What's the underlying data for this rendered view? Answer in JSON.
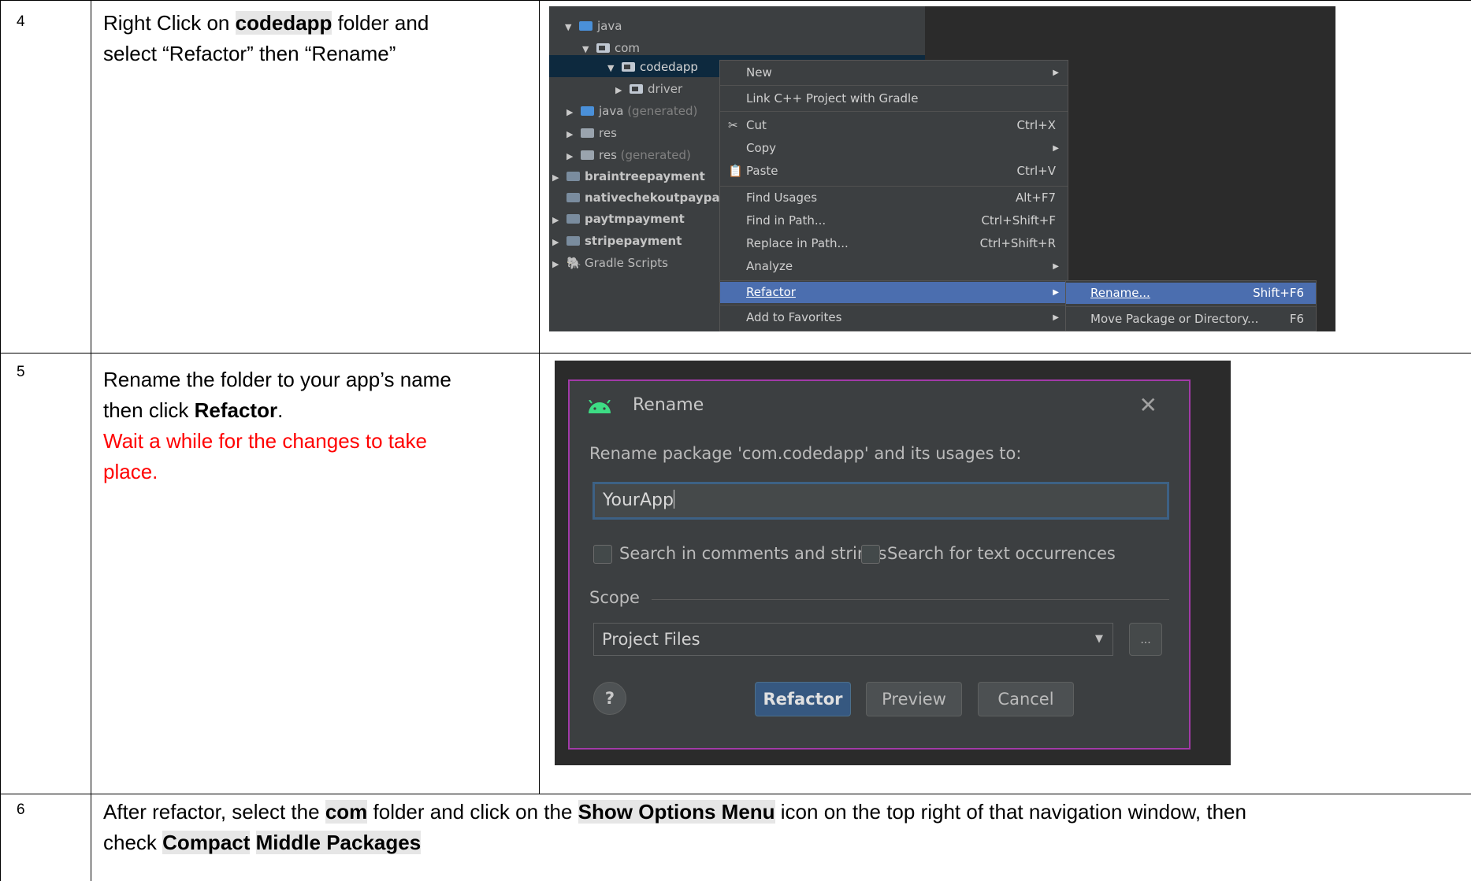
{
  "rows": [
    {
      "num": "4",
      "text_1": "Right Click on ",
      "hl_1": "codedapp",
      "text_2": " folder and",
      "line2": "select “Refactor” then “Rename”"
    },
    {
      "num": "5",
      "line1": "Rename the folder to your app’s name",
      "line2_pre": "then click ",
      "line2_bold": "Refactor",
      "line2_post": ".",
      "warn_line1": "Wait a while for the changes to take",
      "warn_line2": "place.",
      "warn_color": "#ff0000"
    },
    {
      "num": "6",
      "t1": "After refactor, select the ",
      "h1": "com",
      "t2": " folder and click on the ",
      "h2": "Show Options Menu",
      "t3": " icon on the top right of that navigation window, then",
      "t4": "check ",
      "h3": "Compact",
      "h4": "Middle Packages"
    }
  ],
  "ide": {
    "tree": [
      {
        "label": "java",
        "extra": ""
      },
      {
        "label": "com",
        "extra": ""
      },
      {
        "label": "codedapp",
        "extra": ""
      },
      {
        "label": "driver",
        "extra": ""
      },
      {
        "label": "java",
        "extra": " (generated)"
      },
      {
        "label": "res",
        "extra": ""
      },
      {
        "label": "res",
        "extra": " (generated)"
      },
      {
        "label": "braintreepayment",
        "extra": ""
      },
      {
        "label": "nativechekoutpaypal",
        "extra": ""
      },
      {
        "label": "paytmpayment",
        "extra": ""
      },
      {
        "label": "stripepayment",
        "extra": ""
      },
      {
        "label": "Gradle Scripts",
        "extra": ""
      }
    ],
    "menu": [
      {
        "label": "New",
        "key": ""
      },
      {
        "label": "Link C++ Project with Gradle",
        "key": ""
      },
      {
        "label": "Cut",
        "key": "Ctrl+X"
      },
      {
        "label": "Copy",
        "key": ""
      },
      {
        "label": "Paste",
        "key": "Ctrl+V"
      },
      {
        "label": "Find Usages",
        "key": "Alt+F7"
      },
      {
        "label": "Find in Path...",
        "key": "Ctrl+Shift+F"
      },
      {
        "label": "Replace in Path...",
        "key": "Ctrl+Shift+R"
      },
      {
        "label": "Analyze",
        "key": ""
      },
      {
        "label": "Refactor",
        "key": ""
      },
      {
        "label": "Add to Favorites",
        "key": ""
      }
    ],
    "submenu": [
      {
        "label": "Rename...",
        "key": "Shift+F6"
      },
      {
        "label": "Move Package or Directory...",
        "key": "F6"
      }
    ],
    "highlight_color": "#4b6eaf"
  },
  "dialog": {
    "title": "Rename",
    "prompt": "Rename package 'com.codedapp' and its usages to:",
    "input_value": "YourApp",
    "check_comments": "Search in comments and strings",
    "check_text": "Search for text occurrences",
    "scope_label": "Scope",
    "scope_value": "Project Files",
    "ellipsis": "...",
    "help": "?",
    "btn_refactor": "Refactor",
    "btn_preview": "Preview",
    "btn_cancel": "Cancel",
    "border_color": "#a23aa8",
    "android_color": "#3ddc84"
  }
}
